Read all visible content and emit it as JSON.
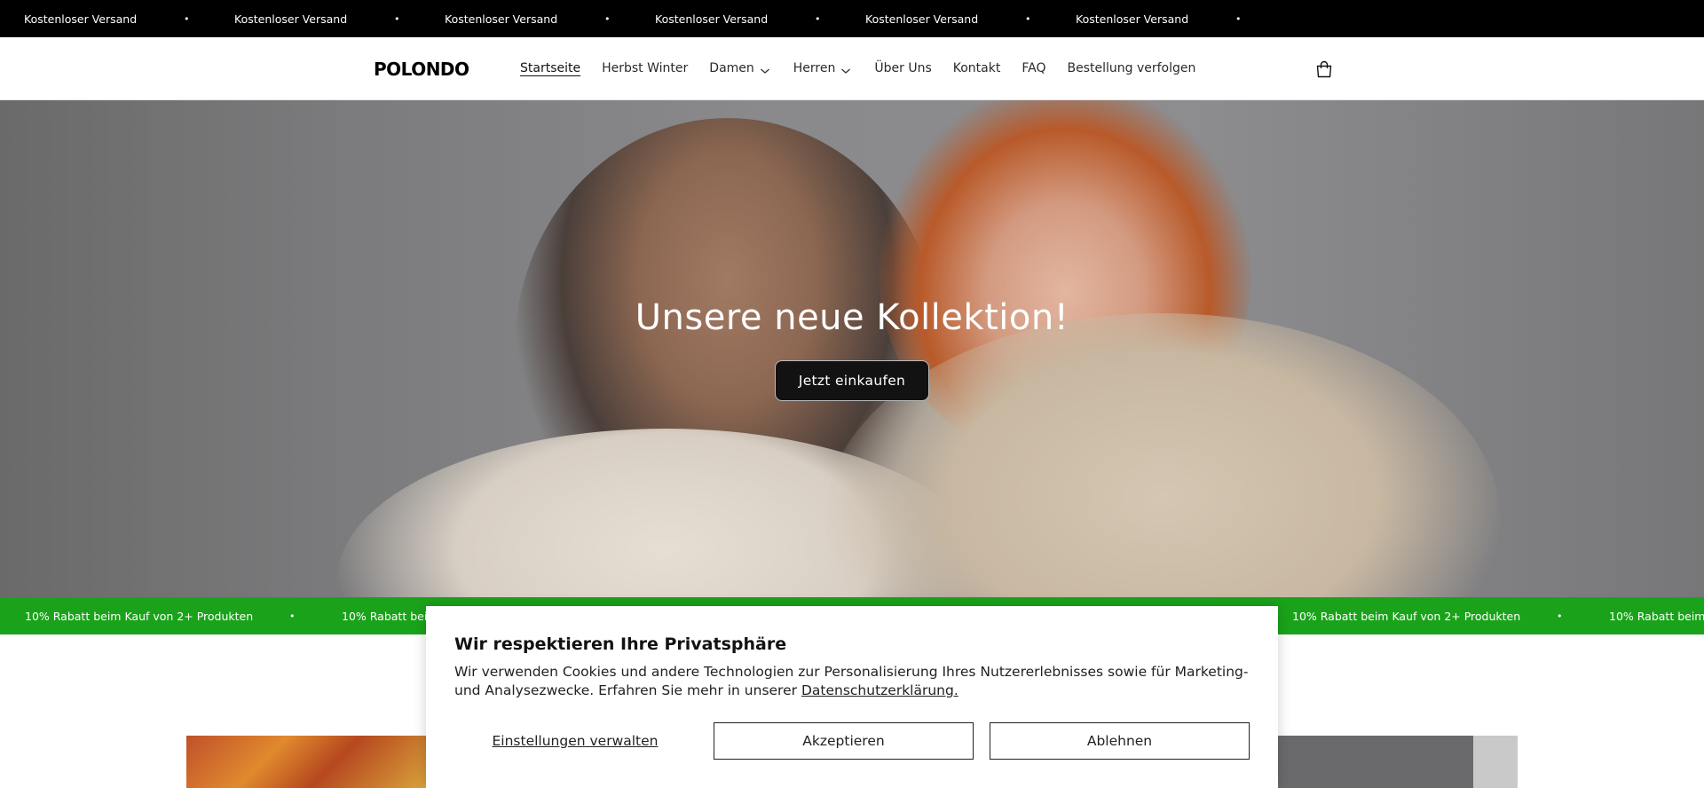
{
  "announcement": {
    "items": [
      "Kostenloser Versand",
      "Kostenloser Versand",
      "Kostenloser Versand",
      "Kostenloser Versand",
      "Kostenloser Versand",
      "Kostenloser Versand"
    ],
    "separator": "•"
  },
  "header": {
    "logo": "POLONDO",
    "nav": [
      {
        "label": "Startseite",
        "active": true,
        "dropdown": false
      },
      {
        "label": "Herbst Winter",
        "active": false,
        "dropdown": false
      },
      {
        "label": "Damen",
        "active": false,
        "dropdown": true
      },
      {
        "label": "Herren",
        "active": false,
        "dropdown": true
      },
      {
        "label": "Über Uns",
        "active": false,
        "dropdown": false
      },
      {
        "label": "Kontakt",
        "active": false,
        "dropdown": false
      },
      {
        "label": "FAQ",
        "active": false,
        "dropdown": false
      },
      {
        "label": "Bestellung verfolgen",
        "active": false,
        "dropdown": false
      }
    ],
    "cart_icon": "shopping-bag-icon"
  },
  "hero": {
    "title": "Unsere neue Kollektion!",
    "button": "Jetzt einkaufen"
  },
  "promo": {
    "items": [
      "10% Rabatt beim Kauf von 2+ Produkten",
      "10% Rabatt beim Kauf von 2+ Produkten",
      "10% Rabatt beim Kauf von 2+ Produkten",
      "10% Rabatt beim Kauf von 2+ Produkten",
      "10% Rabatt beim Kauf von 2+ Produkten",
      "10% Rabatt beim Kauf von 2+ Produkten"
    ],
    "separator": "•",
    "color": "#1aa31a"
  },
  "cookie": {
    "title": "Wir respektieren Ihre Privatsphäre",
    "text": "Wir verwenden Cookies und andere Technologien zur Personalisierung Ihres Nutzererlebnisses sowie für Marketing- und Analysezwecke. Erfahren Sie mehr in unserer",
    "link": "Datenschutzerklärung.",
    "manage": "Einstellungen verwalten",
    "accept": "Akzeptieren",
    "decline": "Ablehnen"
  }
}
